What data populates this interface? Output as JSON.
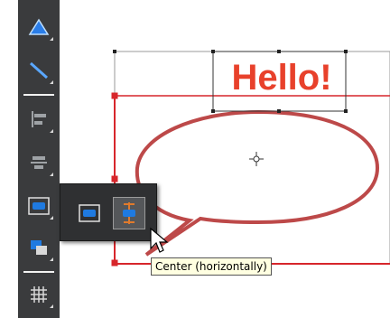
{
  "toolbar": {
    "buttons": [
      {
        "name": "triangle-tool",
        "icon": "triangle-icon"
      },
      {
        "name": "line-tool",
        "icon": "line-icon"
      },
      {
        "name": "align-left-tool",
        "icon": "align-left-icon"
      },
      {
        "name": "align-center-tool",
        "icon": "align-center-icon"
      },
      {
        "name": "center-horizontally-tool",
        "icon": "center-horizontally-icon"
      },
      {
        "name": "arrange-tool",
        "icon": "arrange-icon"
      },
      {
        "name": "grid-tool",
        "icon": "grid-icon"
      }
    ]
  },
  "flyout": {
    "buttons": [
      {
        "icon": "center-vertically-icon",
        "active": false
      },
      {
        "icon": "center-horizontally-icon",
        "active": true
      }
    ]
  },
  "canvas": {
    "text_object": "Hello!",
    "text_color": "#e8412b",
    "shape": "speech-bubble"
  },
  "tooltip": {
    "text": "Center (horizontally)"
  },
  "colors": {
    "toolbar_bg": "#3a3b3d",
    "accent_blue": "#1f7ae0",
    "selection_red": "#d7262b",
    "tooltip_bg": "#ffffe1"
  }
}
